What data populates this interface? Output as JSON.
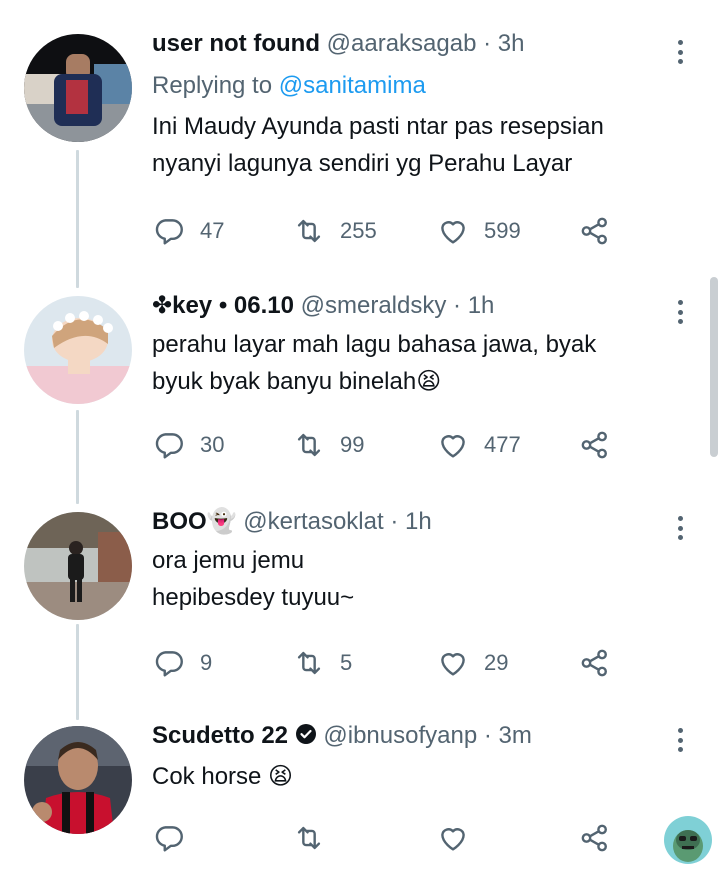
{
  "tweets": [
    {
      "name": "user not found",
      "handle": "@aaraksagab",
      "separator": "·",
      "time": "3h",
      "replying_prefix": "Replying to",
      "replying_handle": "@sanitamima",
      "text_lines": [
        "Ini Maudy Ayunda pasti ntar pas resepsian",
        "nyanyi lagunya sendiri yg Perahu Layar"
      ],
      "replies": "47",
      "retweets": "255",
      "likes": "599"
    },
    {
      "name": "✤key • 06.10",
      "handle": "@smeraldsky",
      "separator": "·",
      "time": "1h",
      "text_lines": [
        "perahu layar mah lagu bahasa jawa, byak",
        "byuk byak banyu binelah😫"
      ],
      "replies": "30",
      "retweets": "99",
      "likes": "477"
    },
    {
      "name": "BOO👻",
      "handle": "@kertasoklat",
      "separator": "·",
      "time": "1h",
      "text_lines": [
        "ora jemu jemu",
        "hepibesdey tuyuu~"
      ],
      "replies": "9",
      "retweets": "5",
      "likes": "29"
    },
    {
      "name": "Scudetto 22",
      "handle": "@ibnusofyanp",
      "separator": "·",
      "time": "3m",
      "text_lines": [
        "Cok horse 😫"
      ],
      "replies": "",
      "retweets": "",
      "likes": ""
    }
  ],
  "icons": {
    "reply": "reply-icon",
    "retweet": "retweet-icon",
    "like": "heart-icon",
    "share": "share-icon",
    "more": "more-icon",
    "verified": "verified-badge-icon"
  },
  "colors": {
    "link": "#1d9bf0",
    "muted": "#536471",
    "text": "#0f1419",
    "thread_line": "#cfd9de"
  }
}
